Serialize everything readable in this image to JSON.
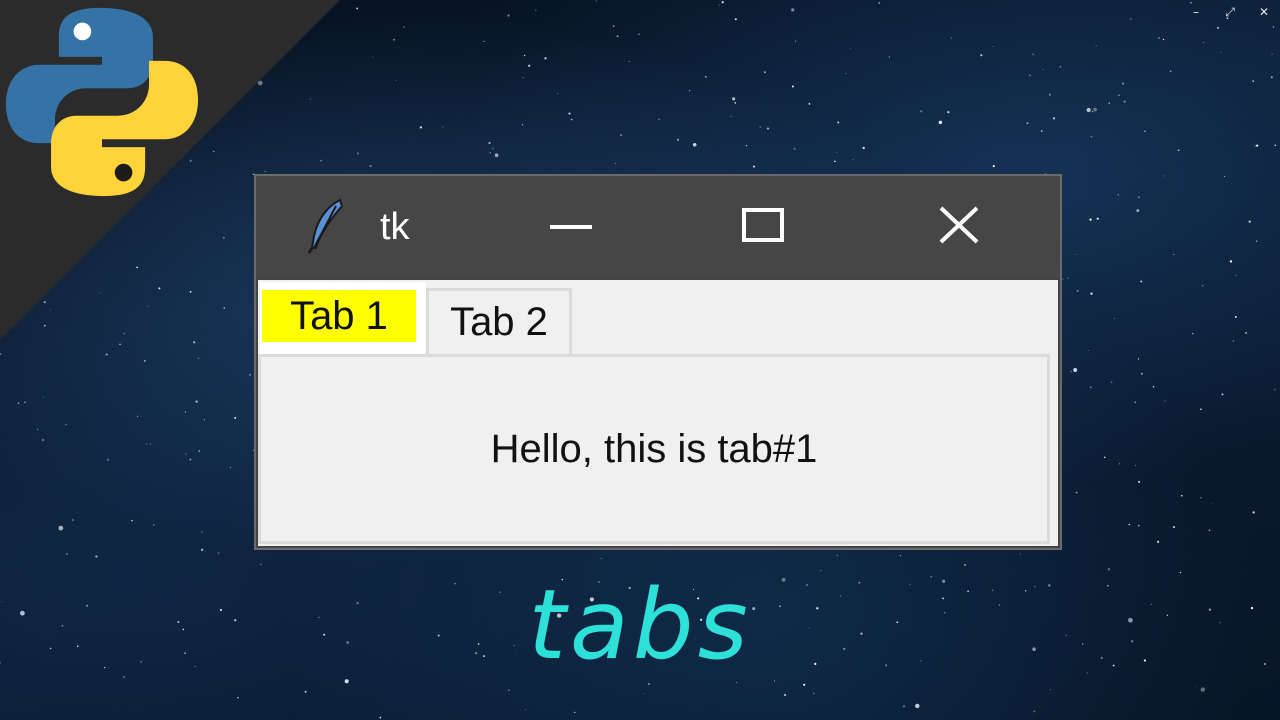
{
  "desktop": {
    "controls": [
      "–",
      "⤢",
      "✕"
    ],
    "caption": "tabs",
    "colors": {
      "caption": "#2de0d8",
      "python_blue": "#3572a5",
      "python_yellow": "#ffd43b"
    }
  },
  "window": {
    "title": "tk",
    "titlebar_color": "#464646",
    "icons": {
      "app": "feather-icon",
      "minimize": "minimize-icon",
      "maximize": "maximize-icon",
      "close": "close-icon"
    }
  },
  "notebook": {
    "tabs": [
      {
        "label": "Tab 1",
        "selected": true,
        "highlight": "#ffff00"
      },
      {
        "label": "Tab 2",
        "selected": false
      }
    ],
    "content_text": "Hello, this is tab#1"
  }
}
